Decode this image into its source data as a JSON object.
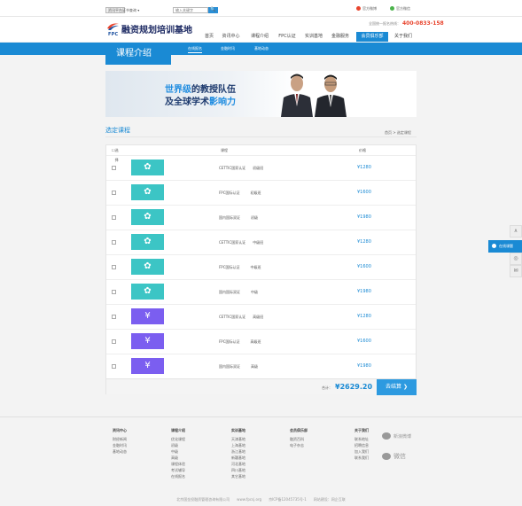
{
  "topbar": {
    "chip": "资讯平台",
    "cert_select": "证书查询 ▾",
    "search_placeholder": "输入关键字",
    "search_button": "🔍",
    "social": [
      "官方微博",
      "官方微信"
    ]
  },
  "header": {
    "logo_name": "融资规划培训基地",
    "logo_abbr": "FPC",
    "hotline_label": "全国统一报名热线：",
    "hotline_number": "400-0833-158",
    "nav": [
      "首页",
      "资讯中心",
      "课程介绍",
      "FPC认证",
      "实训基地",
      "金融服务",
      "会员俱乐部",
      "关于我们"
    ],
    "nav_active": "会员俱乐部"
  },
  "subnav": {
    "items": [
      "在线报名",
      "金融时讯",
      "基地动态"
    ],
    "active": "在线报名"
  },
  "page": {
    "section_title": "课程介绍",
    "banner_line1_a": "世界级",
    "banner_line1_b": "的教授队伍",
    "banner_line2_a": "及全球学术",
    "banner_line2_b": "影响力",
    "list_title": "选定课程",
    "breadcrumb": "首页 > 选定课程"
  },
  "table": {
    "headers": [
      "选择",
      "课程",
      "价格"
    ],
    "rows": [
      {
        "icon": "ribbon-icon",
        "color": "teal",
        "course": "CETTIC国家认证　　初级班",
        "price": "¥1280"
      },
      {
        "icon": "ribbon-icon",
        "color": "teal",
        "course": "FPC国际认证　　　初级班",
        "price": "¥1600"
      },
      {
        "icon": "ribbon-icon",
        "color": "teal",
        "course": "国内国际双证　　　初级",
        "price": "¥1980"
      },
      {
        "icon": "ribbon-icon",
        "color": "teal",
        "course": "CETTIC国家认证　　中级班",
        "price": "¥1280"
      },
      {
        "icon": "ribbon-icon",
        "color": "teal",
        "course": "FPC国际认证　　　中级班",
        "price": "¥1600"
      },
      {
        "icon": "ribbon-icon",
        "color": "teal",
        "course": "国内国际双证　　　中级",
        "price": "¥1980"
      },
      {
        "icon": "yen-icon",
        "color": "purple",
        "course": "CETTIC国家认证　　高级班",
        "price": "¥1280"
      },
      {
        "icon": "yen-icon",
        "color": "purple",
        "course": "FPC国际认证　　　高级班",
        "price": "¥1600"
      },
      {
        "icon": "yen-icon",
        "color": "purple",
        "course": "国内国际双证　　　高级",
        "price": "¥1980"
      }
    ],
    "total_label": "合计：",
    "total": "¥2629.20",
    "checkout": "去结算 ❯"
  },
  "side": {
    "online": "在线课题",
    "tools": [
      "∧",
      "◎",
      "✉"
    ]
  },
  "footer": {
    "columns": [
      {
        "title": "资讯中心",
        "items": [
          "财经新闻",
          "金融时讯",
          "基地动态"
        ]
      },
      {
        "title": "课程介绍",
        "items": [
          "优化课程",
          "初级",
          "中级",
          "高级",
          "课程体验",
          "考试辅导",
          "在线报名"
        ]
      },
      {
        "title": "实训基地",
        "items": [
          "天津基地",
          "上海基地",
          "浙江基地",
          "新疆基地",
          "河北基地",
          "四川基地",
          "其它基地"
        ]
      },
      {
        "title": "会员俱乐部",
        "items": [
          "融资百科",
          "电子杂志"
        ]
      },
      {
        "title": "关于我们",
        "items": [
          "联系地址",
          "招聘信息",
          "加入我们",
          "联系我们"
        ]
      }
    ],
    "social": [
      "新浪微博",
      "微信"
    ],
    "copyright": "北京国金投融资管理咨询有限公司　　www.fpcsj.org　　京ICP备12045735号-1　　网站建设：网企互联"
  }
}
